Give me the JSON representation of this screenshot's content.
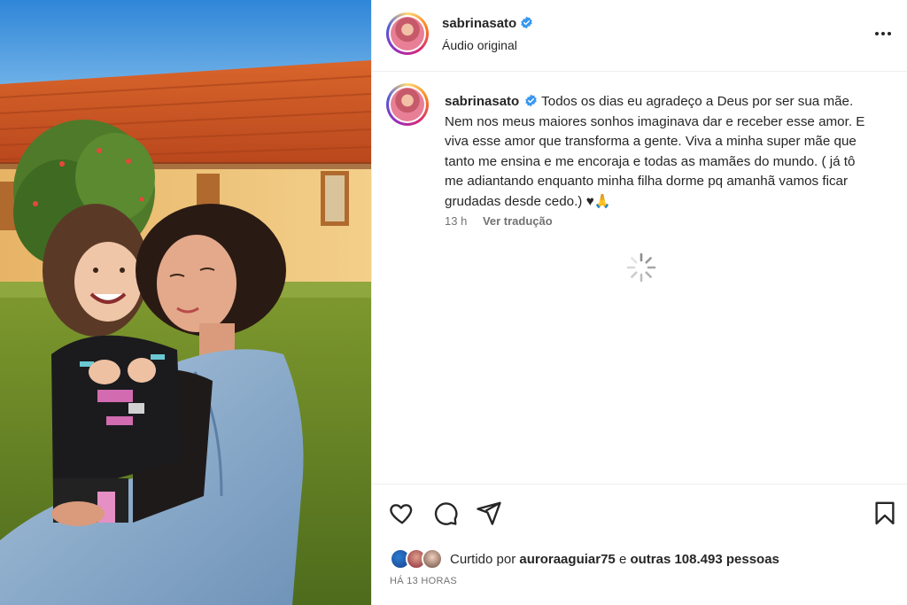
{
  "post": {
    "username": "sabrinasato",
    "audio_label": "Áudio original",
    "caption": "Todos os dias eu agradeço a Deus por ser sua mãe. Nem nos meus maiores sonhos imaginava dar e receber esse amor. E viva esse amor que transforma a gente. Viva a minha super mãe que tanto me ensina e me encoraja e todas as mamães do mundo. ( já tô me adiantando enquanto minha filha dorme pq amanhã vamos ficar grudadas desde cedo.) ♥🙏",
    "time_ago": "13 h",
    "translate_label": "Ver tradução",
    "liked_by_prefix": "Curtido por",
    "liked_by_user": "auroraaguiar75",
    "liked_by_middle": "e",
    "liked_by_others": "outras 108.493 pessoas",
    "timestamp": "HÁ 13 HORAS"
  },
  "colors": {
    "verified": "#3897f0",
    "text": "#262626",
    "muted": "#737373"
  },
  "icons": [
    "more-icon",
    "verified-icon",
    "heart-icon",
    "comment-icon",
    "share-icon",
    "bookmark-icon",
    "loading-spinner-icon"
  ]
}
